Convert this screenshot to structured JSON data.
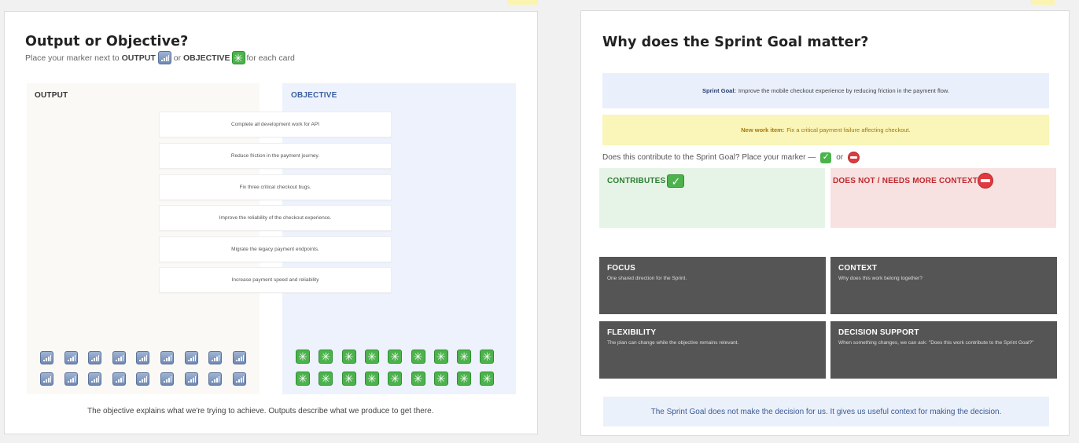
{
  "left": {
    "title": "Output or Objective?",
    "subtitle": {
      "prefix": "Place your marker next to",
      "output_word": "OUTPUT",
      "or": "or",
      "objective_word": "OBJECTIVE",
      "suffix": "for each card"
    },
    "output_label": "OUTPUT",
    "objective_label": "OBJECTIVE",
    "cards": [
      "Complete all development work for API",
      "Reduce friction in the payment journey.",
      "Fix three critical checkout bugs.",
      "Improve the reliability of the checkout experience.",
      "Migrate the legacy payment endpoints.",
      "Increase payment speed and reliability"
    ],
    "output_marker_count": 18,
    "objective_marker_count": 18,
    "footnote": "The objective explains what we're trying to achieve. Outputs describe what we produce to get there."
  },
  "right": {
    "title": "Why does the Sprint Goal matter?",
    "sprint_goal_label": "Sprint Goal:",
    "sprint_goal_text": "Improve the mobile checkout experience by reducing friction in the payment flow.",
    "new_work_label": "New work item:",
    "new_work_text": "Fix a critical payment failure affecting checkout.",
    "question": {
      "text": "Does this contribute to the Sprint Goal? Place your marker —",
      "or": "or"
    },
    "contributes_label": "CONTRIBUTES",
    "not_label": "DOES NOT / NEEDS MORE CONTEXT",
    "cards": [
      {
        "title": "FOCUS",
        "desc": "One shared direction for the Sprint."
      },
      {
        "title": "CONTEXT",
        "desc": "Why does this work belong together?"
      },
      {
        "title": "FLEXIBILITY",
        "desc": "The plan can change while the objective remains relevant."
      },
      {
        "title": "DECISION SUPPORT",
        "desc": "When something changes, we can ask: \"Does this work contribute to the Sprint Goal?\""
      }
    ],
    "footer": "The Sprint Goal does not make the decision for us. It gives us useful context for making the decision."
  },
  "colors": {
    "output_zone": "#fbf9f6",
    "objective_zone": "#edf2fc",
    "objective_text": "#3a5fa0",
    "sprint_banner": "#eaf0fb",
    "new_work_banner": "#faf5b8",
    "new_work_label": "#a0780f",
    "contributes_bg": "#e5f4e6",
    "contributes_text": "#2e7d32",
    "not_bg": "#f8e1e1",
    "not_text": "#c0282d",
    "dark_card": "#555555",
    "footer_banner": "#ebf1fb",
    "footer_text": "#3b5a96"
  },
  "icons": [
    "signal-icon",
    "sparkle-icon",
    "check-icon",
    "no-entry-icon"
  ]
}
